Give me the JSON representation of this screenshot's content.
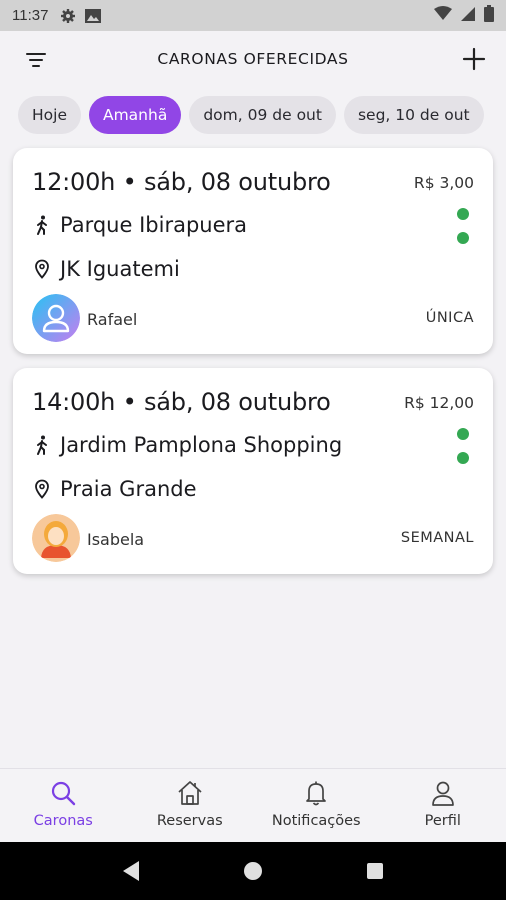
{
  "status_bar": {
    "time": "11:37",
    "icons": [
      "gear-icon",
      "image-icon",
      "wifi-icon",
      "signal-icon",
      "battery-icon"
    ]
  },
  "header": {
    "title": "CARONAS OFERECIDAS",
    "left_icon": "filter-icon",
    "right_icon": "plus-icon"
  },
  "date_chips": [
    {
      "label": "Hoje",
      "selected": false
    },
    {
      "label": "Amanhã",
      "selected": true
    },
    {
      "label": "dom, 09 de out",
      "selected": false
    },
    {
      "label": "seg, 10 de out",
      "selected": false
    }
  ],
  "rides": [
    {
      "when": "12:00h • sáb, 08 outubro",
      "price": "R$ 3,00",
      "origin": "Parque Ibirapuera",
      "destination": "JK Iguatemi",
      "driver": "Rafael",
      "frequency": "ÚNICA"
    },
    {
      "when": "14:00h • sáb, 08 outubro",
      "price": "R$ 12,00",
      "origin": "Jardim Pamplona Shopping",
      "destination": "Praia Grande",
      "driver": "Isabela",
      "frequency": "SEMANAL"
    }
  ],
  "bottom_nav": [
    {
      "label": "Caronas",
      "icon": "search-icon",
      "active": true
    },
    {
      "label": "Reservas",
      "icon": "house-icon",
      "active": false
    },
    {
      "label": "Notificações",
      "icon": "bell-icon",
      "active": false
    },
    {
      "label": "Perfil",
      "icon": "person-icon",
      "active": false
    }
  ],
  "colors": {
    "accent": "#9146e6",
    "status_dot": "#34a853",
    "background": "#f3f2f5"
  }
}
